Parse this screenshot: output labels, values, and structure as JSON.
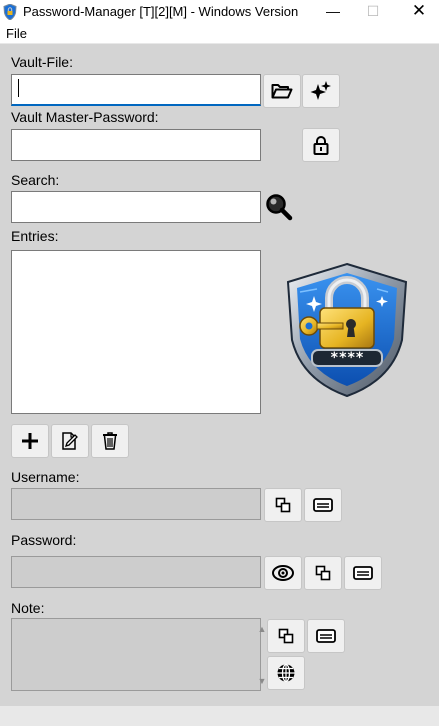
{
  "window": {
    "title": "Password-Manager [T][2][M] - Windows Version",
    "minimize_glyph": "—",
    "maximize_glyph": "☐",
    "close_glyph": "✕"
  },
  "menu": {
    "file": "File"
  },
  "vault_file": {
    "label": "Vault-File:",
    "value": "",
    "open_icon": "folder-open-icon",
    "new_icon": "sparkle-new-icon"
  },
  "master_password": {
    "label": "Vault Master-Password:",
    "value": "",
    "unlock_icon": "lock-icon"
  },
  "search": {
    "label": "Search:",
    "value": "",
    "icon": "magnifier-icon"
  },
  "entries": {
    "label": "Entries:",
    "items": [],
    "add_icon": "plus-icon",
    "edit_icon": "edit-document-icon",
    "delete_icon": "trash-icon"
  },
  "logo": {
    "name": "shield-padlock-logo",
    "mask_text": "****"
  },
  "username": {
    "label": "Username:",
    "value": "",
    "copy_icon": "copy-icon",
    "keyboard_icon": "keyboard-icon"
  },
  "password": {
    "label": "Password:",
    "value": "",
    "show_icon": "eye-icon",
    "copy_icon": "copy-icon",
    "keyboard_icon": "keyboard-icon"
  },
  "note": {
    "label": "Note:",
    "value": "",
    "scroll_up": "▲",
    "scroll_down": "▼",
    "copy_icon": "copy-icon",
    "keyboard_icon": "keyboard-icon",
    "web_icon": "globe-icon"
  },
  "colors": {
    "accent": "#0067c0",
    "background": "#d4d4d4",
    "shield_blue": "#1a6fd6",
    "lock_gold": "#e6b422"
  }
}
